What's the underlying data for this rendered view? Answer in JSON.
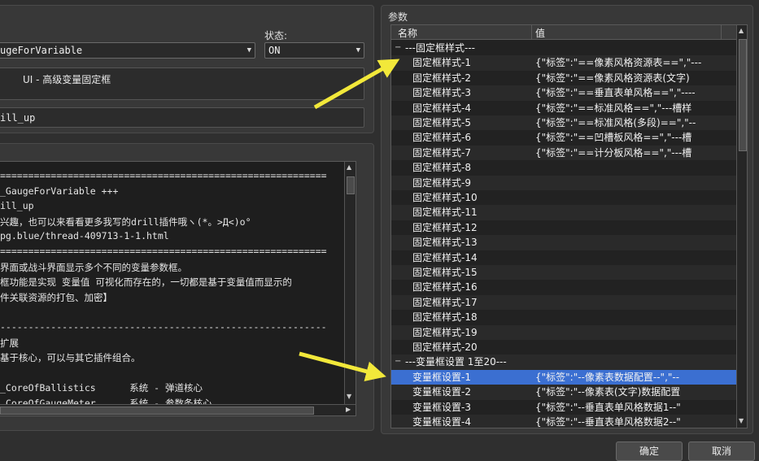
{
  "left_panel": {
    "status_label": "状态:",
    "plugin_select": "ugeForVariable",
    "status_select": "ON",
    "description": "UI - 高级变量固定框",
    "author_field": "ill_up"
  },
  "notes": {
    "lines": [
      "==========================================================",
      "_GaugeForVariable +++",
      "ill_up",
      "兴趣，也可以来看看更多我写的drill插件哦ヽ(*。>Д<)o°",
      "pg.blue/thread-409713-1-1.html",
      "==========================================================",
      "界面或战斗界面显示多个不同的变量参数框。",
      "框功能是实现 变量值 可视化而存在的，一切都是基于变量值而显示的",
      "件关联资源的打包、加密】",
      "",
      "----------------------------------------------------------",
      "扩展",
      "基于核心，可以与其它插件组合。",
      "",
      "_CoreOfBallistics      系统 - 弹道核心",
      "_CoreOfGaugeMeter      系统 - 参数条核心"
    ]
  },
  "params": {
    "title": "参数",
    "col_name": "名称",
    "col_value": "值",
    "rows": [
      {
        "name": "---固定框样式---",
        "value": "",
        "group": true,
        "expander": "−"
      },
      {
        "name": "固定框样式-1",
        "value": "{\"标签\":\"==像素风格资源表==\",\"---"
      },
      {
        "name": "固定框样式-2",
        "value": "{\"标签\":\"==像素风格资源表(文字)"
      },
      {
        "name": "固定框样式-3",
        "value": "{\"标签\":\"==垂直表单风格==\",\"----"
      },
      {
        "name": "固定框样式-4",
        "value": "{\"标签\":\"==标准风格==\",\"---槽样"
      },
      {
        "name": "固定框样式-5",
        "value": "{\"标签\":\"==标准风格(多段)==\",\"--"
      },
      {
        "name": "固定框样式-6",
        "value": "{\"标签\":\"==凹槽板风格==\",\"---槽"
      },
      {
        "name": "固定框样式-7",
        "value": "{\"标签\":\"==计分板风格==\",\"---槽"
      },
      {
        "name": "固定框样式-8",
        "value": ""
      },
      {
        "name": "固定框样式-9",
        "value": ""
      },
      {
        "name": "固定框样式-10",
        "value": ""
      },
      {
        "name": "固定框样式-11",
        "value": ""
      },
      {
        "name": "固定框样式-12",
        "value": ""
      },
      {
        "name": "固定框样式-13",
        "value": ""
      },
      {
        "name": "固定框样式-14",
        "value": ""
      },
      {
        "name": "固定框样式-15",
        "value": ""
      },
      {
        "name": "固定框样式-16",
        "value": ""
      },
      {
        "name": "固定框样式-17",
        "value": ""
      },
      {
        "name": "固定框样式-18",
        "value": ""
      },
      {
        "name": "固定框样式-19",
        "value": ""
      },
      {
        "name": "固定框样式-20",
        "value": ""
      },
      {
        "name": "---变量框设置 1至20---",
        "value": "",
        "group": true,
        "expander": "−"
      },
      {
        "name": "变量框设置-1",
        "value": "{\"标签\":\"--像素表数据配置--\",\"--",
        "selected": true
      },
      {
        "name": "变量框设置-2",
        "value": "{\"标签\":\"--像素表(文字)数据配置"
      },
      {
        "name": "变量框设置-3",
        "value": "{\"标签\":\"--垂直表单风格数据1--\""
      },
      {
        "name": "变量框设置-4",
        "value": "{\"标签\":\"--垂直表单风格数据2--\""
      }
    ]
  },
  "buttons": {
    "ok": "确定",
    "cancel": "取消"
  },
  "colors": {
    "selection": "#3b6fd1",
    "arrow": "#f2e83a"
  }
}
